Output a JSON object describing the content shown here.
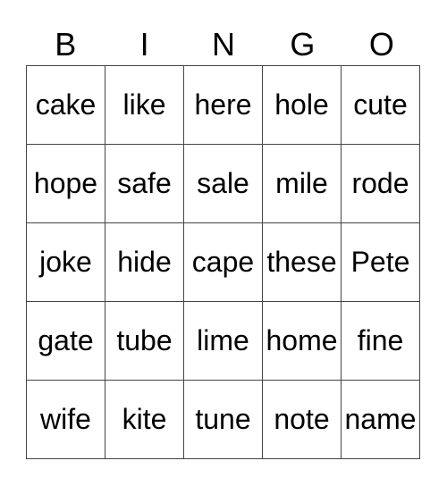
{
  "header": [
    "B",
    "I",
    "N",
    "G",
    "O"
  ],
  "grid": [
    [
      "cake",
      "like",
      "here",
      "hole",
      "cute"
    ],
    [
      "hope",
      "safe",
      "sale",
      "mile",
      "rode"
    ],
    [
      "joke",
      "hide",
      "cape",
      "these",
      "Pete"
    ],
    [
      "gate",
      "tube",
      "lime",
      "home",
      "fine"
    ],
    [
      "wife",
      "kite",
      "tune",
      "note",
      "name"
    ]
  ]
}
